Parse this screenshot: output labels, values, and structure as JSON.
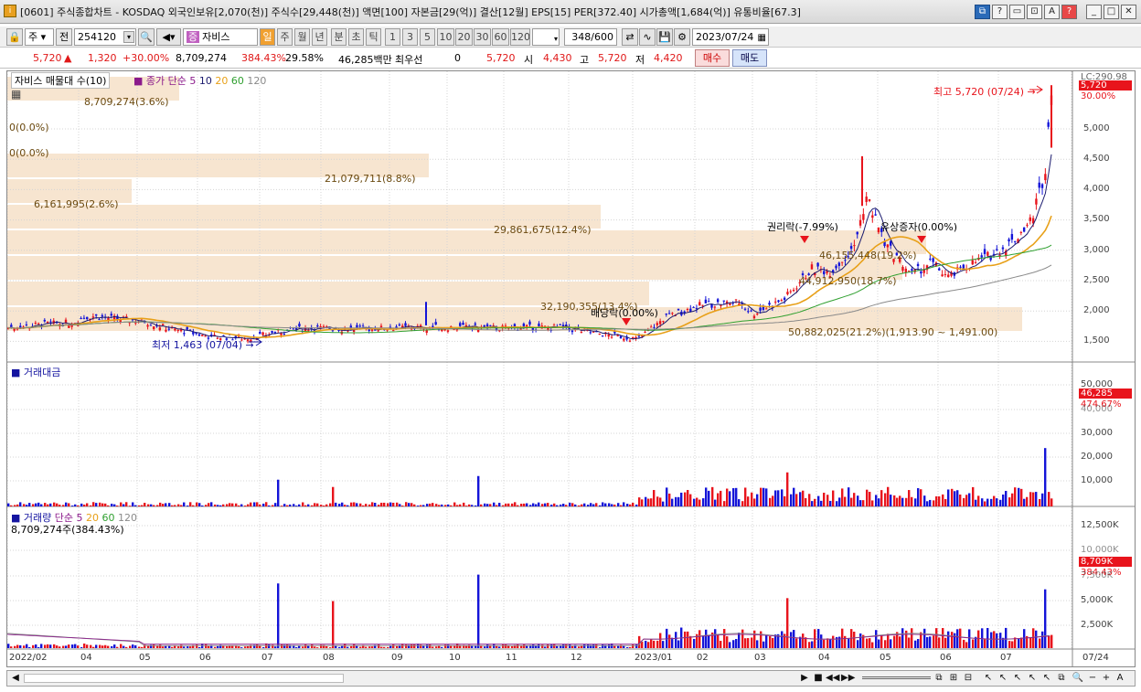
{
  "window": {
    "title": "[0601] 주식종합차트 - KOSDAQ 외국인보유[2,070(천)] 주식수[29,448(천)] 액면[100] 자본금[29(억)] 결산[12월] EPS[15] PER[372.40] 시가총액[1,684(억)] 유통비율[67.3]"
  },
  "toolbar": {
    "market": "주",
    "prefix": "전",
    "code": "254120",
    "name": "자비스",
    "periods": [
      "일",
      "주",
      "월",
      "년",
      "분",
      "초",
      "틱"
    ],
    "active_period": "일",
    "minute_options": [
      "1",
      "3",
      "5",
      "10",
      "20",
      "30",
      "60",
      "120"
    ],
    "count": "348",
    "count_total": "/600",
    "date": "2023/07/24"
  },
  "quote": {
    "price": "5,720",
    "arrow": "▲",
    "change": "1,320",
    "change_pct": "+30.00%",
    "volume": "8,709,274",
    "vol_ratio": "384.43%",
    "turnover": "29.58%",
    "amount": "46,285백만",
    "best_label": "최우선",
    "best_value": "0",
    "best_price": "5,720",
    "open_label": "시",
    "open": "4,430",
    "high_label": "고",
    "high": "5,720",
    "low_label": "저",
    "low": "4,420",
    "buy": "매수",
    "sell": "매도"
  },
  "price_panel": {
    "legend_name": "자비스 매물대 수(10)",
    "legend_ma": "종가 단순",
    "ma_periods": [
      "5",
      "10",
      "20",
      "60",
      "120"
    ],
    "lc_label": "LC:290.98",
    "last_price_tag": "5,720",
    "last_pct_tag": "30.00%",
    "high_annot": "최고 5,720 (07/24) →",
    "low_annot": "최저 1,463 (07/04) →",
    "event_rights": "권리락(-7.99%)",
    "event_rights_offer": "유상증자(0.00%)",
    "event_dividend": "배당락(0.00%)",
    "volume_profile": [
      {
        "label": "8,709,274(3.6%)",
        "share": 3.6
      },
      {
        "label": "0(0.0%)",
        "share": 0
      },
      {
        "label": "0(0.0%)",
        "share": 0
      },
      {
        "label": "21,079,711(8.8%)",
        "share": 8.8
      },
      {
        "label": "6,161,995(2.6%)",
        "share": 2.6
      },
      {
        "label": "29,861,675(12.4%)",
        "share": 12.4
      },
      {
        "label": "46,155,448(19.2%)",
        "share": 19.2
      },
      {
        "label": "44,912,950(18.7%)",
        "share": 18.7
      },
      {
        "label": "32,190,355(13.4%)",
        "share": 13.4
      },
      {
        "label": "50,882,025(21.2%)(1,913.90 ~ 1,491.00)",
        "share": 21.2
      }
    ],
    "y_ticks": [
      "5,000",
      "4,500",
      "4,000",
      "3,500",
      "3,000",
      "2,500",
      "2,000",
      "1,500"
    ]
  },
  "amount_panel": {
    "title": "거래대금",
    "last_tag": "46,285",
    "last_pct": "474.67%",
    "y_ticks": [
      "50,000",
      "40,000",
      "30,000",
      "20,000",
      "10,000"
    ]
  },
  "volume_panel": {
    "legend_name": "거래량",
    "legend_ma": "단순",
    "ma_periods": [
      "5",
      "20",
      "60",
      "120"
    ],
    "last_vol": "8,709,274주(384.43%)",
    "last_tag": "8,709K",
    "last_pct": "384.43%",
    "y_ticks": [
      "12,500K",
      "10,000K",
      "7,500K",
      "5,000K",
      "2,500K"
    ]
  },
  "x_axis": {
    "labels": [
      "2022/02",
      "04",
      "05",
      "06",
      "07",
      "08",
      "09",
      "10",
      "11",
      "12",
      "2023/01",
      "02",
      "03",
      "04",
      "05",
      "06",
      "07"
    ],
    "right_label": "07/24"
  },
  "colors": {
    "up": "#e8141c",
    "down": "#1414d8",
    "ma5": "#1a1a6e",
    "ma10": "#e8a018",
    "ma20": "#e8a018",
    "ma60": "#30a030",
    "ma120": "#8a8a8a",
    "profile": "#f7e5d0"
  }
}
